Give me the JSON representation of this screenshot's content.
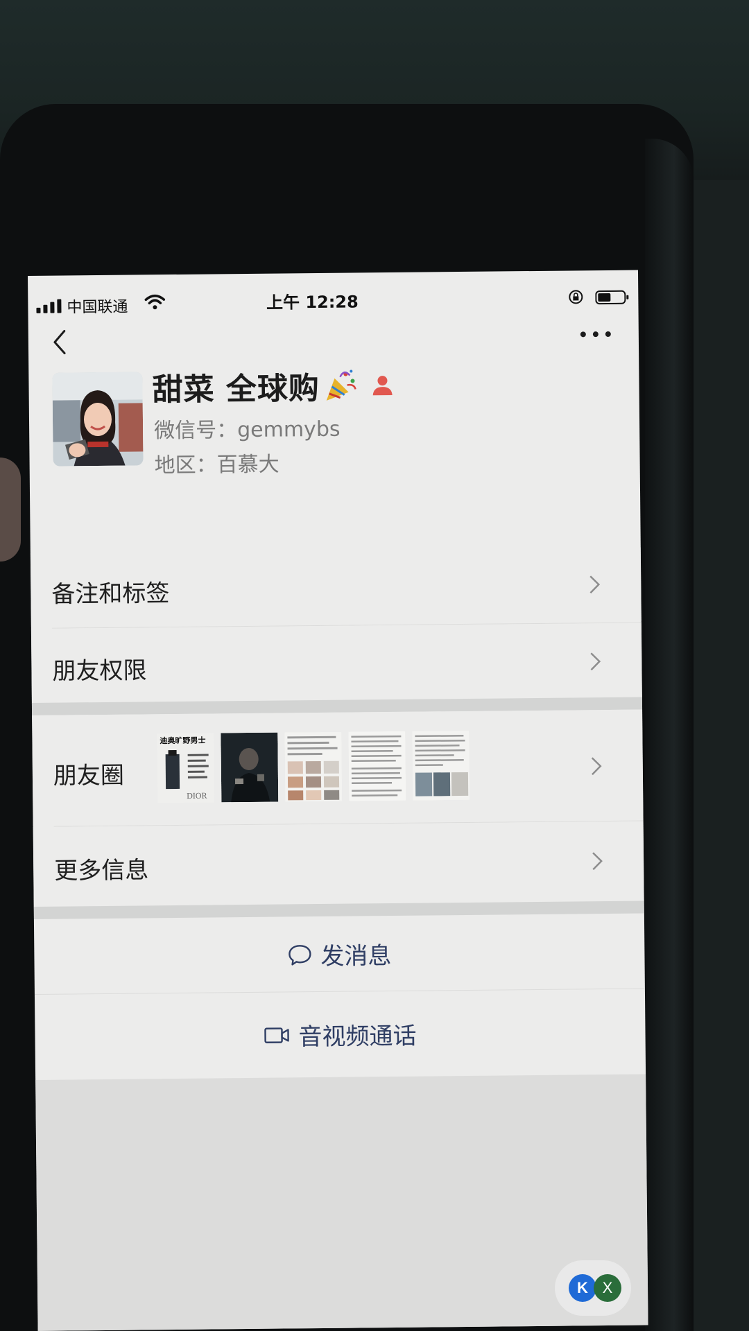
{
  "status_bar": {
    "carrier": "中国联通",
    "time": "上午 12:28"
  },
  "contact": {
    "name": "甜菜 全球购",
    "wechat_id": "微信号：gemmybs",
    "region": "地区：百慕大"
  },
  "rows": {
    "remark_tags": "备注和标签",
    "friend_permissions": "朋友权限",
    "moments": "朋友圈",
    "more_info": "更多信息"
  },
  "moments_thumbs": [
    {
      "title": "迪奥旷野男士",
      "brand": "DIOR"
    },
    {
      "title": ""
    },
    {
      "title": ""
    },
    {
      "title": ""
    },
    {
      "title": ""
    }
  ],
  "actions": {
    "send_message": "发消息",
    "av_call": "音视频通话"
  },
  "floating": {
    "k": "K",
    "x": "X"
  },
  "colors": {
    "accent_link": "#2f3e64",
    "screen_bg": "#ececeb",
    "divider": "#d3d4d3"
  },
  "icons": [
    "back-icon",
    "more-icon",
    "party-popper-icon",
    "person-icon",
    "chevron-right-icon",
    "chat-bubble-icon",
    "video-camera-icon",
    "wifi-icon",
    "battery-icon",
    "rotation-lock-icon"
  ]
}
